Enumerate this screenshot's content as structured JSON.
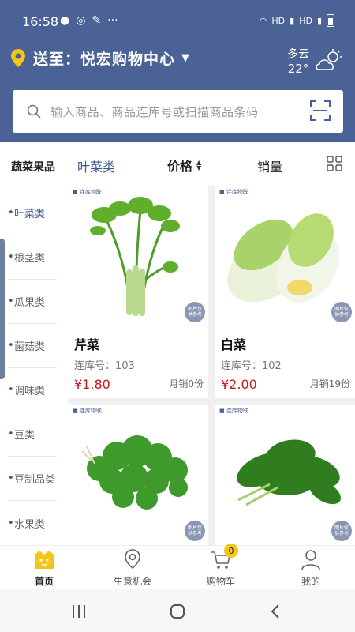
{
  "status": {
    "time": "16:58",
    "net1": "HD",
    "net2": "HD"
  },
  "header": {
    "location_label": "送至：悦宏购物中心",
    "weather_desc": "多云",
    "weather_temp": "22°"
  },
  "search": {
    "placeholder": "输入商品、商品连库号或扫描商品条码"
  },
  "sidebar": {
    "title": "蔬菜果品",
    "items": [
      {
        "label": "叶菜类",
        "active": true
      },
      {
        "label": "根茎类"
      },
      {
        "label": "瓜果类"
      },
      {
        "label": "菌菇类"
      },
      {
        "label": "调味类"
      },
      {
        "label": "豆类"
      },
      {
        "label": "豆制品类"
      },
      {
        "label": "水果类"
      }
    ]
  },
  "sortbar": {
    "category": "叶菜类",
    "price_label": "价格",
    "sales_label": "销量"
  },
  "products": [
    {
      "name": "芹菜",
      "code": "连库号：103",
      "price": "¥1.80",
      "sold": "月销0份",
      "badge": "图片仅供参考"
    },
    {
      "name": "白菜",
      "code": "连库号：102",
      "price": "¥2.00",
      "sold": "月销19份",
      "badge": "图片仅供参考"
    },
    {
      "name": "",
      "code": "",
      "price": "",
      "sold": "",
      "badge": "图片仅供参考"
    },
    {
      "name": "",
      "code": "",
      "price": "",
      "sold": "",
      "badge": "图片仅供参考"
    }
  ],
  "bottom_nav": [
    {
      "label": "首页",
      "icon": "home-icon",
      "active": true
    },
    {
      "label": "生意机会",
      "icon": "location-pin-icon"
    },
    {
      "label": "购物车",
      "icon": "cart-icon",
      "badge": "0"
    },
    {
      "label": "我的",
      "icon": "user-icon"
    }
  ],
  "colors": {
    "header_bg": "#4a6296",
    "accent": "#3e5a8f",
    "price": "#c8161e",
    "badge": "#f5c518"
  }
}
